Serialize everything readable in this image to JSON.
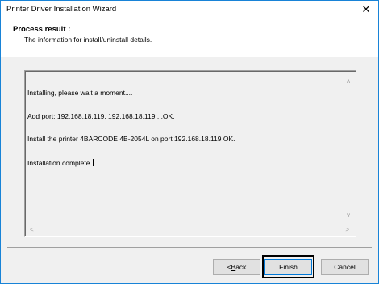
{
  "window": {
    "title": "Printer Driver Installation Wizard",
    "close_symbol": "✕"
  },
  "header": {
    "title": "Process result :",
    "subtitle": "The information for install/uninstall details."
  },
  "log": {
    "lines": [
      "Installing, please wait a moment....",
      "Add port: 192.168.18.119, 192.168.18.119 ...OK.",
      "Install the printer 4BARCODE 4B-2054L on port 192.168.18.119 OK.",
      "Installation complete."
    ]
  },
  "buttons": {
    "back_prefix": "< ",
    "back_mnemonic": "B",
    "back_rest": "ack",
    "finish": "Finish",
    "cancel": "Cancel"
  }
}
